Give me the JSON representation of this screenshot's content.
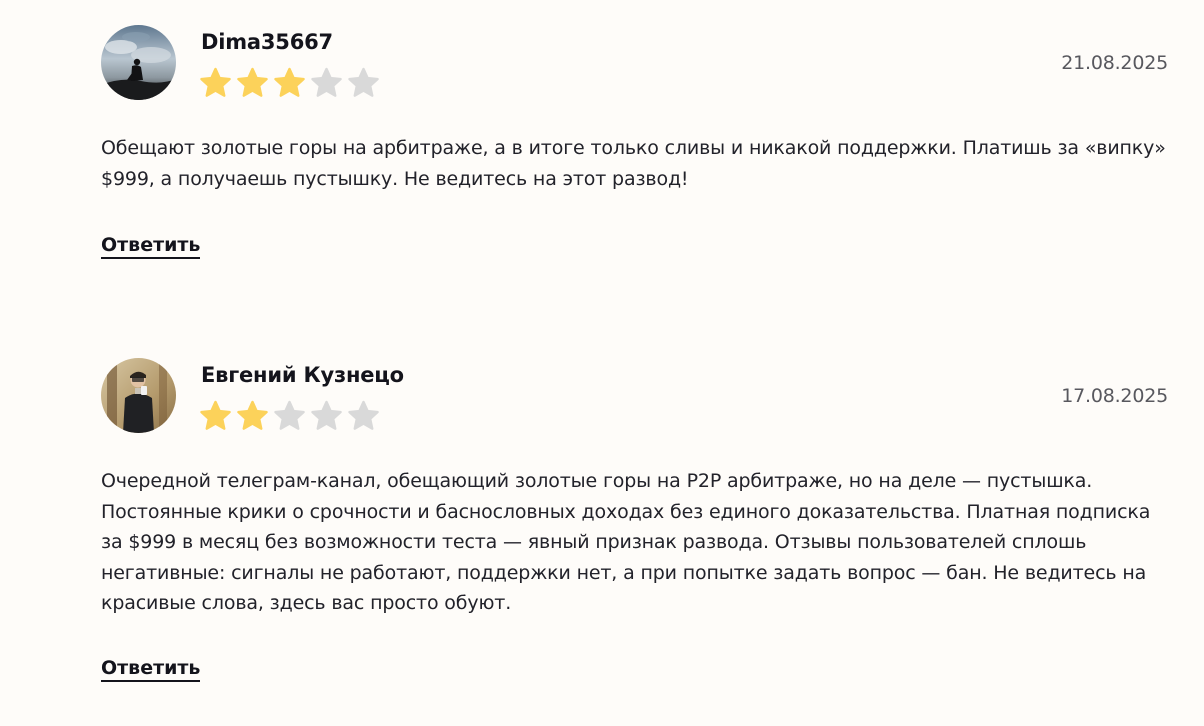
{
  "reviews": [
    {
      "author": "Dima35667",
      "date": "21.08.2025",
      "rating": 3,
      "max_rating": 5,
      "text": "Обещают золотые горы на арбитраже, а в итоге только сливы и никакой поддержки. Платишь за «випку» $999, а получаешь пустышку. Не ведитесь на этот развод!",
      "reply_label": "Ответить",
      "avatar_icon": "user-photo-silhouette-sky"
    },
    {
      "author": "Евгений Кузнецо",
      "date": "17.08.2025",
      "rating": 2,
      "max_rating": 5,
      "text": "Очередной телеграм-канал, обещающий золотые горы на P2P арбитраже, но на деле — пустышка. Постоянные крики о срочности и баснословных доходах без единого доказательства. Платная подписка за $999 в месяц без возможности теста — явный признак развода. Отзывы пользователей сплошь негативные: сигналы не работают, поддержки нет, а при попытке задать вопрос — бан. Не ведитесь на красивые слова, здесь вас просто обуют.",
      "reply_label": "Ответить",
      "avatar_icon": "user-photo-mirror-selfie"
    }
  ],
  "colors": {
    "star_filled": "#fcd25a",
    "star_empty": "#d9d9d9",
    "text": "#22222a",
    "date": "#58585e",
    "background": "#fefcf9"
  }
}
